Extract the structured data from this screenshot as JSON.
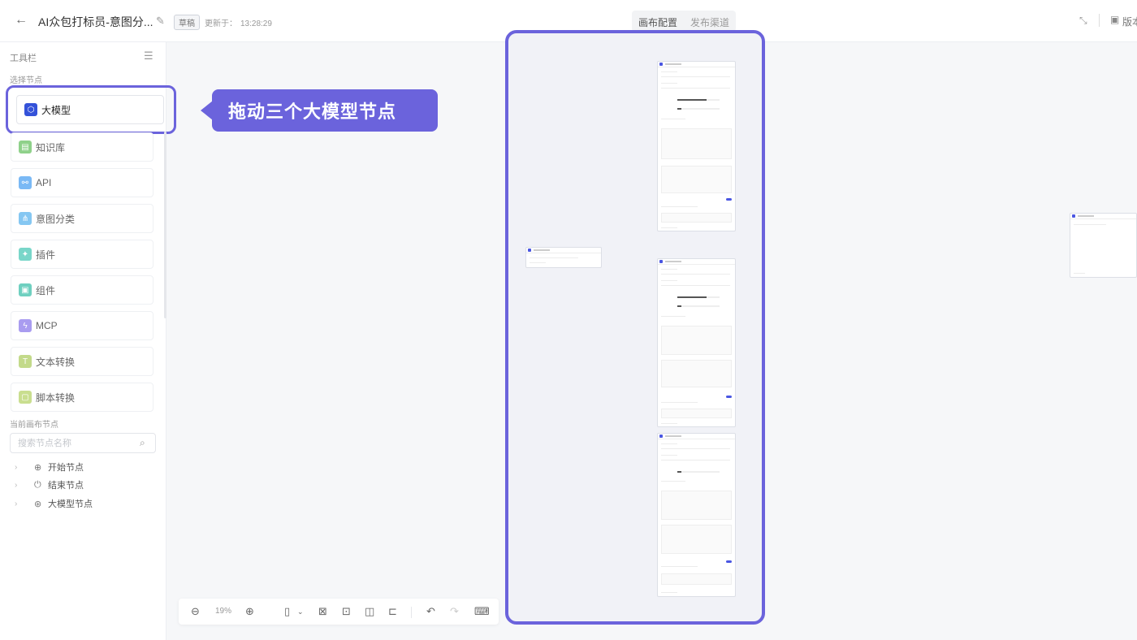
{
  "header": {
    "title": "AI众包打标员-意图分...",
    "badge": "草稿",
    "updated_label": "更新于：",
    "updated_time": "13:28:29",
    "tabs": [
      {
        "label": "画布配置",
        "active": true
      },
      {
        "label": "发布渠道",
        "active": false
      }
    ],
    "right_label": "版本"
  },
  "sidebar": {
    "title": "工具栏",
    "section_label": "选择节点",
    "tools": [
      {
        "label": "大模型",
        "icon": "model-icon",
        "color": "#3452d9"
      },
      {
        "label": "知识库",
        "icon": "knowledge-icon",
        "color": "#8fd18a"
      },
      {
        "label": "API",
        "icon": "api-icon",
        "color": "#7ab9f5"
      },
      {
        "label": "意图分类",
        "icon": "intent-icon",
        "color": "#85c7f2"
      },
      {
        "label": "插件",
        "icon": "plugin-icon",
        "color": "#79d6c9"
      },
      {
        "label": "组件",
        "icon": "component-icon",
        "color": "#6fd0c0"
      },
      {
        "label": "MCP",
        "icon": "mcp-icon",
        "color": "#a99cf0"
      },
      {
        "label": "文本转换",
        "icon": "text-icon",
        "color": "#c3da8a"
      },
      {
        "label": "脚本转换",
        "icon": "script-icon",
        "color": "#c9de8f"
      }
    ],
    "canvas_nodes_label": "当前画布节点",
    "search_placeholder": "搜索节点名称",
    "tree": [
      {
        "label": "开始节点",
        "icon": "start-icon"
      },
      {
        "label": "结束节点",
        "icon": "power-icon"
      },
      {
        "label": "大模型节点",
        "icon": "model-node-icon"
      }
    ]
  },
  "callout": {
    "text": "拖动三个大模型节点"
  },
  "zoombar": {
    "zoom": "19%"
  },
  "colors": {
    "accent": "#6b63dc",
    "primary": "#3452d9"
  }
}
